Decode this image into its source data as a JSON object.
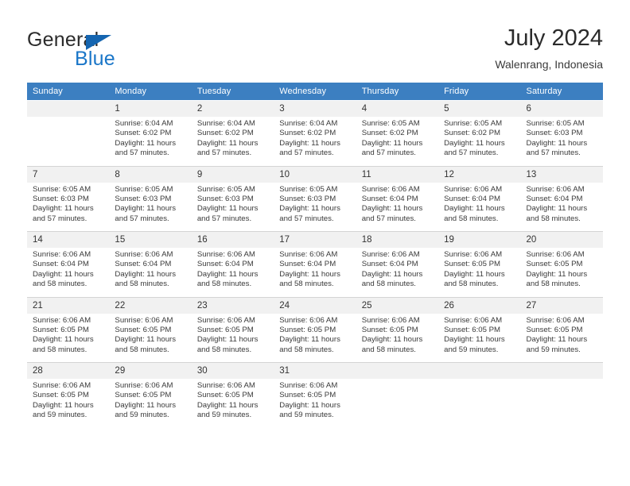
{
  "brand": {
    "name_part1": "General",
    "name_part2": "Blue",
    "triangle_color": "#1565b0",
    "blue_color": "#1a76c8"
  },
  "header": {
    "title": "July 2024",
    "subtitle": "Walenrang, Indonesia",
    "header_bg": "#3c7fc1",
    "date_bg": "#f1f1f1"
  },
  "weekdays": [
    "Sunday",
    "Monday",
    "Tuesday",
    "Wednesday",
    "Thursday",
    "Friday",
    "Saturday"
  ],
  "labels": {
    "sunrise": "Sunrise:",
    "sunset": "Sunset:",
    "daylight": "Daylight:"
  },
  "weeks": [
    [
      {
        "day": "",
        "sunrise": "",
        "sunset": "",
        "daylight_1": "",
        "daylight_2": ""
      },
      {
        "day": "1",
        "sunrise": "Sunrise: 6:04 AM",
        "sunset": "Sunset: 6:02 PM",
        "daylight_1": "Daylight: 11 hours",
        "daylight_2": "and 57 minutes."
      },
      {
        "day": "2",
        "sunrise": "Sunrise: 6:04 AM",
        "sunset": "Sunset: 6:02 PM",
        "daylight_1": "Daylight: 11 hours",
        "daylight_2": "and 57 minutes."
      },
      {
        "day": "3",
        "sunrise": "Sunrise: 6:04 AM",
        "sunset": "Sunset: 6:02 PM",
        "daylight_1": "Daylight: 11 hours",
        "daylight_2": "and 57 minutes."
      },
      {
        "day": "4",
        "sunrise": "Sunrise: 6:05 AM",
        "sunset": "Sunset: 6:02 PM",
        "daylight_1": "Daylight: 11 hours",
        "daylight_2": "and 57 minutes."
      },
      {
        "day": "5",
        "sunrise": "Sunrise: 6:05 AM",
        "sunset": "Sunset: 6:02 PM",
        "daylight_1": "Daylight: 11 hours",
        "daylight_2": "and 57 minutes."
      },
      {
        "day": "6",
        "sunrise": "Sunrise: 6:05 AM",
        "sunset": "Sunset: 6:03 PM",
        "daylight_1": "Daylight: 11 hours",
        "daylight_2": "and 57 minutes."
      }
    ],
    [
      {
        "day": "7",
        "sunrise": "Sunrise: 6:05 AM",
        "sunset": "Sunset: 6:03 PM",
        "daylight_1": "Daylight: 11 hours",
        "daylight_2": "and 57 minutes."
      },
      {
        "day": "8",
        "sunrise": "Sunrise: 6:05 AM",
        "sunset": "Sunset: 6:03 PM",
        "daylight_1": "Daylight: 11 hours",
        "daylight_2": "and 57 minutes."
      },
      {
        "day": "9",
        "sunrise": "Sunrise: 6:05 AM",
        "sunset": "Sunset: 6:03 PM",
        "daylight_1": "Daylight: 11 hours",
        "daylight_2": "and 57 minutes."
      },
      {
        "day": "10",
        "sunrise": "Sunrise: 6:05 AM",
        "sunset": "Sunset: 6:03 PM",
        "daylight_1": "Daylight: 11 hours",
        "daylight_2": "and 57 minutes."
      },
      {
        "day": "11",
        "sunrise": "Sunrise: 6:06 AM",
        "sunset": "Sunset: 6:04 PM",
        "daylight_1": "Daylight: 11 hours",
        "daylight_2": "and 57 minutes."
      },
      {
        "day": "12",
        "sunrise": "Sunrise: 6:06 AM",
        "sunset": "Sunset: 6:04 PM",
        "daylight_1": "Daylight: 11 hours",
        "daylight_2": "and 58 minutes."
      },
      {
        "day": "13",
        "sunrise": "Sunrise: 6:06 AM",
        "sunset": "Sunset: 6:04 PM",
        "daylight_1": "Daylight: 11 hours",
        "daylight_2": "and 58 minutes."
      }
    ],
    [
      {
        "day": "14",
        "sunrise": "Sunrise: 6:06 AM",
        "sunset": "Sunset: 6:04 PM",
        "daylight_1": "Daylight: 11 hours",
        "daylight_2": "and 58 minutes."
      },
      {
        "day": "15",
        "sunrise": "Sunrise: 6:06 AM",
        "sunset": "Sunset: 6:04 PM",
        "daylight_1": "Daylight: 11 hours",
        "daylight_2": "and 58 minutes."
      },
      {
        "day": "16",
        "sunrise": "Sunrise: 6:06 AM",
        "sunset": "Sunset: 6:04 PM",
        "daylight_1": "Daylight: 11 hours",
        "daylight_2": "and 58 minutes."
      },
      {
        "day": "17",
        "sunrise": "Sunrise: 6:06 AM",
        "sunset": "Sunset: 6:04 PM",
        "daylight_1": "Daylight: 11 hours",
        "daylight_2": "and 58 minutes."
      },
      {
        "day": "18",
        "sunrise": "Sunrise: 6:06 AM",
        "sunset": "Sunset: 6:04 PM",
        "daylight_1": "Daylight: 11 hours",
        "daylight_2": "and 58 minutes."
      },
      {
        "day": "19",
        "sunrise": "Sunrise: 6:06 AM",
        "sunset": "Sunset: 6:05 PM",
        "daylight_1": "Daylight: 11 hours",
        "daylight_2": "and 58 minutes."
      },
      {
        "day": "20",
        "sunrise": "Sunrise: 6:06 AM",
        "sunset": "Sunset: 6:05 PM",
        "daylight_1": "Daylight: 11 hours",
        "daylight_2": "and 58 minutes."
      }
    ],
    [
      {
        "day": "21",
        "sunrise": "Sunrise: 6:06 AM",
        "sunset": "Sunset: 6:05 PM",
        "daylight_1": "Daylight: 11 hours",
        "daylight_2": "and 58 minutes."
      },
      {
        "day": "22",
        "sunrise": "Sunrise: 6:06 AM",
        "sunset": "Sunset: 6:05 PM",
        "daylight_1": "Daylight: 11 hours",
        "daylight_2": "and 58 minutes."
      },
      {
        "day": "23",
        "sunrise": "Sunrise: 6:06 AM",
        "sunset": "Sunset: 6:05 PM",
        "daylight_1": "Daylight: 11 hours",
        "daylight_2": "and 58 minutes."
      },
      {
        "day": "24",
        "sunrise": "Sunrise: 6:06 AM",
        "sunset": "Sunset: 6:05 PM",
        "daylight_1": "Daylight: 11 hours",
        "daylight_2": "and 58 minutes."
      },
      {
        "day": "25",
        "sunrise": "Sunrise: 6:06 AM",
        "sunset": "Sunset: 6:05 PM",
        "daylight_1": "Daylight: 11 hours",
        "daylight_2": "and 58 minutes."
      },
      {
        "day": "26",
        "sunrise": "Sunrise: 6:06 AM",
        "sunset": "Sunset: 6:05 PM",
        "daylight_1": "Daylight: 11 hours",
        "daylight_2": "and 59 minutes."
      },
      {
        "day": "27",
        "sunrise": "Sunrise: 6:06 AM",
        "sunset": "Sunset: 6:05 PM",
        "daylight_1": "Daylight: 11 hours",
        "daylight_2": "and 59 minutes."
      }
    ],
    [
      {
        "day": "28",
        "sunrise": "Sunrise: 6:06 AM",
        "sunset": "Sunset: 6:05 PM",
        "daylight_1": "Daylight: 11 hours",
        "daylight_2": "and 59 minutes."
      },
      {
        "day": "29",
        "sunrise": "Sunrise: 6:06 AM",
        "sunset": "Sunset: 6:05 PM",
        "daylight_1": "Daylight: 11 hours",
        "daylight_2": "and 59 minutes."
      },
      {
        "day": "30",
        "sunrise": "Sunrise: 6:06 AM",
        "sunset": "Sunset: 6:05 PM",
        "daylight_1": "Daylight: 11 hours",
        "daylight_2": "and 59 minutes."
      },
      {
        "day": "31",
        "sunrise": "Sunrise: 6:06 AM",
        "sunset": "Sunset: 6:05 PM",
        "daylight_1": "Daylight: 11 hours",
        "daylight_2": "and 59 minutes."
      },
      {
        "day": "",
        "sunrise": "",
        "sunset": "",
        "daylight_1": "",
        "daylight_2": ""
      },
      {
        "day": "",
        "sunrise": "",
        "sunset": "",
        "daylight_1": "",
        "daylight_2": ""
      },
      {
        "day": "",
        "sunrise": "",
        "sunset": "",
        "daylight_1": "",
        "daylight_2": ""
      }
    ]
  ]
}
